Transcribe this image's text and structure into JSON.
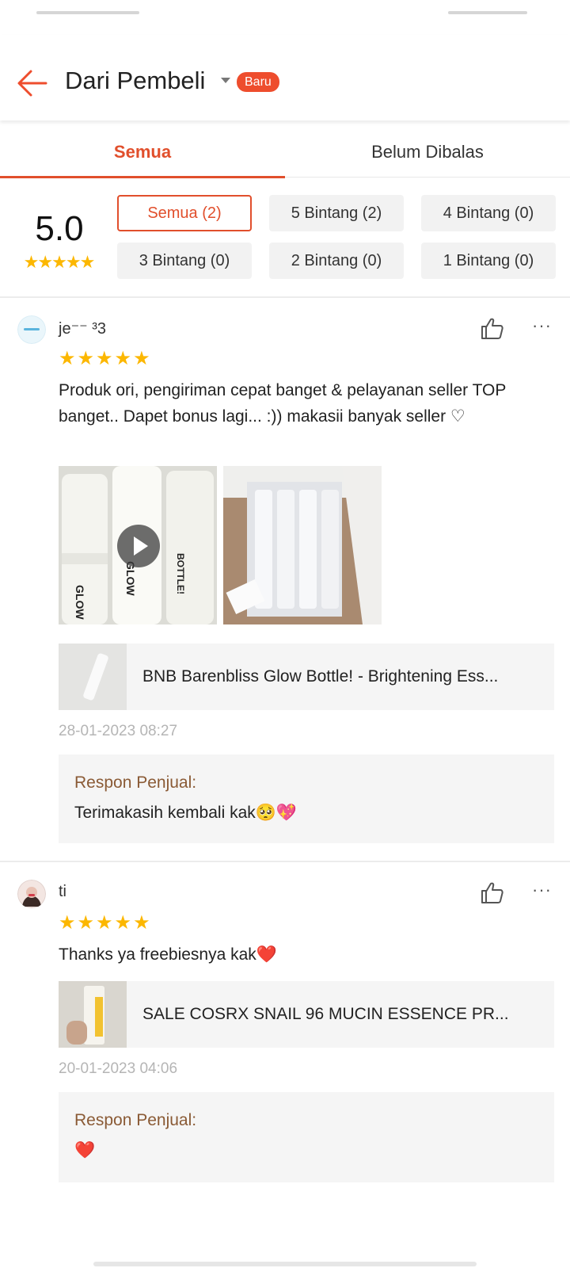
{
  "header": {
    "title": "Dari Pembeli",
    "badge": "Baru",
    "accent_color": "#ee4d2d"
  },
  "tabs": [
    {
      "label": "Semua",
      "active": true
    },
    {
      "label": "Belum Dibalas",
      "active": false
    }
  ],
  "rating": {
    "score": "5.0",
    "stars": 5,
    "filters": [
      {
        "label": "Semua (2)",
        "selected": true
      },
      {
        "label": "5 Bintang (2)",
        "selected": false
      },
      {
        "label": "4 Bintang (0)",
        "selected": false
      },
      {
        "label": "3 Bintang (0)",
        "selected": false
      },
      {
        "label": "2 Bintang (0)",
        "selected": false
      },
      {
        "label": "1 Bintang (0)",
        "selected": false
      }
    ]
  },
  "reviews": [
    {
      "username": "je⁻⁻ ³3",
      "stars": 5,
      "comment": "Produk ori, pengiriman cepat banget & pelayanan seller TOP banget.. Dapet bonus lagi... :)) makasii banyak seller ♡",
      "media": [
        "video-thumbnail",
        "image-thumbnail"
      ],
      "product": "BNB Barenbliss Glow Bottle! - Brightening Ess...",
      "date": "28-01-2023 08:27",
      "response_title": "Respon Penjual:",
      "response_text": "Terimakasih kembali kak🥺💖"
    },
    {
      "username": "ti",
      "stars": 5,
      "comment": "Thanks ya freebiesnya kak❤️",
      "media": [],
      "product": "SALE COSRX SNAIL 96 MUCIN ESSENCE PR...",
      "date": "20-01-2023 04:06",
      "response_title": "Respon Penjual:",
      "response_text": "❤️"
    }
  ],
  "icons": [
    "back-arrow-icon",
    "dropdown-caret-icon",
    "thumbs-up-icon",
    "more-options-icon",
    "play-icon",
    "star-icon"
  ]
}
